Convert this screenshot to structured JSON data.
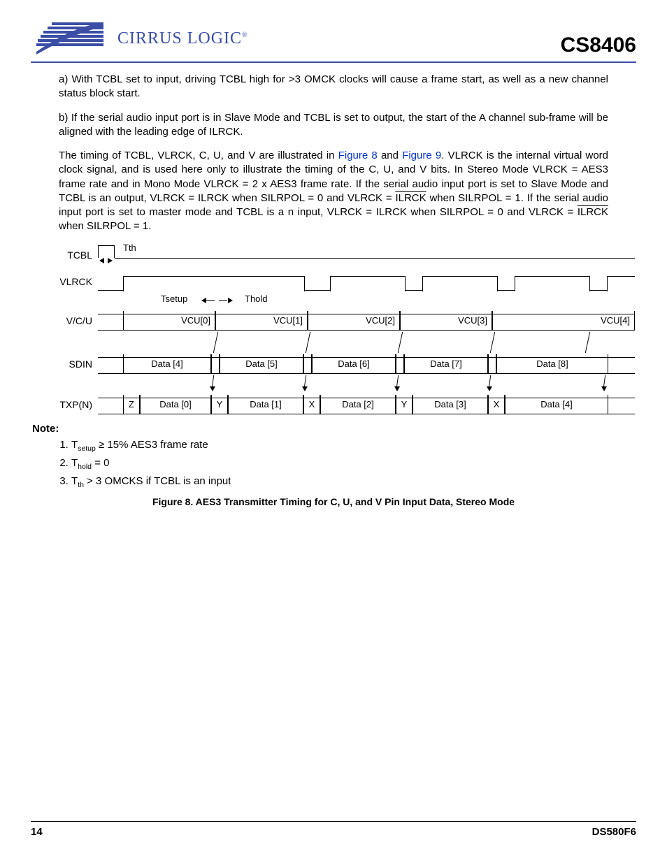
{
  "header": {
    "brand_text": "CIRRUS LOGIC",
    "part_number": "CS8406"
  },
  "paragraphs": {
    "a": "a) With TCBL set to input, driving TCBL high for >3 OMCK clocks will cause a frame start, as well as a new channel status block start.",
    "b": "b) If the serial audio input port is in Slave Mode and TCBL is set to output, the start of the A channel sub-frame will be aligned with the leading edge of ILRCK.",
    "c_pre": "The timing of TCBL, VLRCK, C, U, and V are illustrated in ",
    "fig8": "Figure 8",
    "c_mid": " and ",
    "fig9": "Figure 9",
    "c_post1": ". VLRCK is the internal virtual word clock signal, and is used here only to illustrate the timing of the C, U, and V bits. In Stereo Mode VLRCK = AES3 frame rate and in Mono Mode VLRCK = 2 x AES3 frame rate. If the serial audio input port is set to Slave Mode and TCBL is an  output, VLRCK = ILRCK when SILRPOL = 0 and VLRCK = ",
    "ilrck1": "ILRCK",
    "c_post2": " when SILRPOL = 1. If the serial audio input port is set to   master mode and TCBL is a  n input, VLRCK = ILRCK when SILRPOL = 0 and VLRCK = ",
    "ilrck2": "ILRCK",
    "c_post3": " when SILRPOL = 1."
  },
  "diagram": {
    "signals": {
      "tcbl": "TCBL",
      "vlrck": "VLRCK",
      "vcu": "V/C/U",
      "sdin": "SDIN",
      "txp": "TXP(N)"
    },
    "timing_labels": {
      "tth": "Tth",
      "tsetup": "Tsetup",
      "thold": "Thold"
    },
    "vcu_cells": [
      "VCU[0]",
      "VCU[1]",
      "VCU[2]",
      "VCU[3]",
      "VCU[4]"
    ],
    "sdin_cells": [
      "Data [4]",
      "Data [5]",
      "Data [6]",
      "Data [7]",
      "Data [8]"
    ],
    "txp_pre": [
      "Z",
      "Y",
      "X",
      "Y",
      "X"
    ],
    "txp_data": [
      "Data [0]",
      "Data [1]",
      "Data [2]",
      "Data [3]",
      "Data [4]"
    ]
  },
  "notes": {
    "heading": "Note:",
    "items_html": {
      "n1_pre": "T",
      "n1_sub": "setup",
      "n1_post": " ≥ 15% AES3 frame rate",
      "n2_pre": "T",
      "n2_sub": "hold",
      "n2_post": " = 0",
      "n3_pre": "T",
      "n3_sub": "th",
      "n3_post": " > 3 OMCKS if TCBL is an input"
    }
  },
  "figure_caption": "Figure 8.  AES3 Transmitter Timing for C, U, and V Pin Input Data, Stereo Mode",
  "footer": {
    "page": "14",
    "docid": "DS580F6"
  }
}
